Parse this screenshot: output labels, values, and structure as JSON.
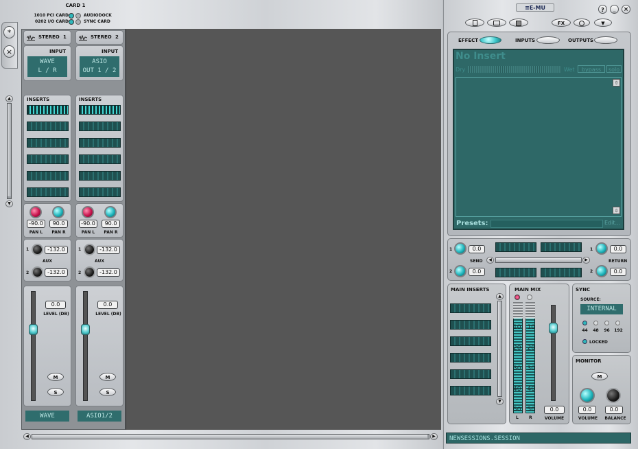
{
  "card": {
    "title": "CARD 1",
    "left_labels": [
      "1010 PCI CARD",
      "0202 I/O CARD"
    ],
    "right_labels": [
      "AUDIODOCK",
      "SYNC CARD"
    ]
  },
  "side_tabs": [
    "*",
    "×"
  ],
  "strips": [
    {
      "name": "STEREO",
      "num": "1",
      "input_label": "INPUT",
      "input_line1": "WAVE",
      "input_line2": "L / R",
      "inserts_label": "INSERTS",
      "pan_l": "-90.0",
      "pan_r": "90.0",
      "pan_l_label": "PAN L",
      "pan_r_label": "PAN R",
      "aux1": "-132.0",
      "aux2": "-132.0",
      "aux_label": "AUX",
      "aux1_num": "1",
      "aux2_num": "2",
      "level": "0.0",
      "level_label": "LEVEL (DB)",
      "mute": "M",
      "solo": "S",
      "footer": "WAVE"
    },
    {
      "name": "STEREO",
      "num": "2",
      "input_label": "INPUT",
      "input_line1": "ASIO",
      "input_line2": "OUT 1 / 2",
      "inserts_label": "INSERTS",
      "pan_l": "-90.0",
      "pan_r": "90.0",
      "pan_l_label": "PAN L",
      "pan_r_label": "PAN R",
      "aux1": "-132.0",
      "aux2": "-132.0",
      "aux_label": "AUX",
      "aux1_num": "1",
      "aux2_num": "2",
      "level": "0.0",
      "level_label": "LEVEL (DB)",
      "mute": "M",
      "solo": "S",
      "footer": "ASIO1/2"
    }
  ],
  "brand": "E-MU",
  "window_buttons": [
    "?",
    "_",
    "×"
  ],
  "toolbar": {
    "fx": "FX"
  },
  "effect_tabs": {
    "effect": "EFFECT",
    "inputs": "INPUTS",
    "outputs": "OUTPUTS"
  },
  "insert_panel": {
    "title": "No Insert",
    "dry": "Dry",
    "wet": "Wet",
    "bypass": "bypass",
    "solo": "solo",
    "presets": "Presets:",
    "edit": "Edit..."
  },
  "sends": {
    "send_label": "SEND",
    "return_label": "RETURN",
    "send1": "0.0",
    "send2": "0.0",
    "return1": "0.0",
    "return2": "0.0",
    "n1": "1",
    "n2": "2"
  },
  "main_inserts": {
    "label": "MAIN INSERTS"
  },
  "main_mix": {
    "label": "MAIN MIX",
    "scale": [
      "10",
      "20",
      "30",
      "40",
      "50"
    ],
    "l": "L",
    "r": "R",
    "volume": "0.0",
    "volume_label": "VOLUME"
  },
  "sync": {
    "label": "SYNC",
    "source_label": "SOURCE:",
    "source": "INTERNAL",
    "rates": [
      "44",
      "48",
      "96",
      "192"
    ],
    "locked": "LOCKED"
  },
  "monitor": {
    "label": "MONITOR",
    "mute": "M",
    "volume": "0.0",
    "balance": "0.0",
    "volume_label": "VOLUME",
    "balance_label": "BALANCE"
  },
  "status": {
    "session": "NEWSESSIONS.SESSION"
  }
}
